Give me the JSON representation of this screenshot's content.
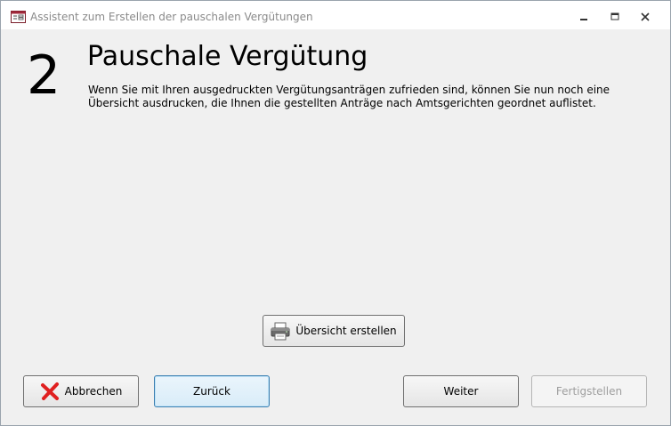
{
  "window": {
    "title": "Assistent zum Erstellen der pauschalen Vergütungen",
    "app_icon": "form-icon",
    "controls": {
      "minimize": "minimize-icon",
      "maximize": "maximize-icon",
      "close": "close-icon"
    }
  },
  "page": {
    "step_number": "2",
    "heading": "Pauschale Vergütung",
    "description": "Wenn Sie mit Ihren ausgedruckten Vergütungsanträgen zufrieden sind, können Sie nun noch eine Übersicht ausdrucken, die Ihnen die gestellten Anträge nach Amtsgerichten geordnet auflistet."
  },
  "buttons": {
    "overview": {
      "label": "Übersicht erstellen",
      "icon": "printer-icon"
    },
    "cancel": {
      "label": "Abbrechen",
      "icon": "red-x-icon"
    },
    "back": {
      "label": "Zurück"
    },
    "next": {
      "label": "Weiter"
    },
    "finish": {
      "label": "Fertigstellen",
      "enabled": false
    }
  },
  "colors": {
    "cancel_icon": "#e02020",
    "focus_border": "#3c7fb1",
    "disabled_text": "#9e9e9e"
  }
}
